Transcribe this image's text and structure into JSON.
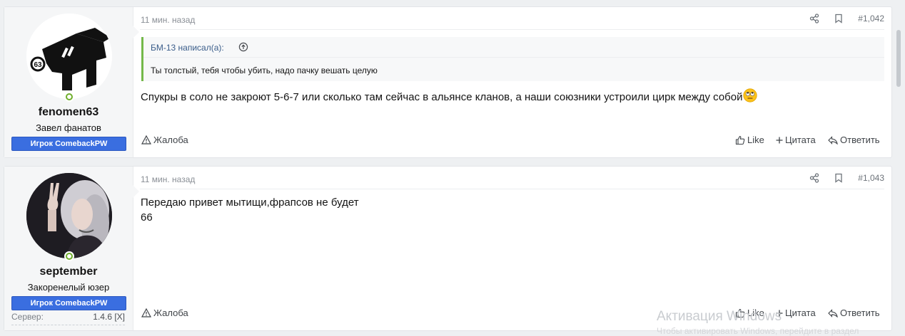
{
  "posts": [
    {
      "username": "fenomen63",
      "user_title": "Завел фанатов",
      "banner": "Игрок ComebackPW",
      "time": "11 мин. назад",
      "post_number": "#1,042",
      "quote": {
        "author": "БМ-13 написал(а):",
        "text": "Ты толстый, тебя чтобы убить, надо пачку вешать целую"
      },
      "message_lines": [
        "Спукры в соло не закроют 5-6-7 или сколько там сейчас в альянсе кланов, а наши союзники устроили цирк между собой"
      ],
      "report_label": "Жалоба",
      "like_label": "Like",
      "quote_label": "Цитата",
      "reply_label": "Ответить"
    },
    {
      "username": "september",
      "user_title": "Закоренелый юзер",
      "banner": "Игрок ComebackPW",
      "extra_label": "Сервер:",
      "extra_value": "1.4.6 [X]",
      "time": "11 мин. назад",
      "post_number": "#1,043",
      "message_lines": [
        "Передаю привет мытищи,фрапсов не будет",
        "66"
      ],
      "report_label": "Жалоба",
      "like_label": "Like",
      "quote_label": "Цитата",
      "reply_label": "Ответить"
    }
  ],
  "watermark": {
    "line1": "Активация Windows",
    "line2": "Чтобы активировать Windows, перейдите в раздел"
  },
  "colors": {
    "banner": "#3a6ee0",
    "quote_border": "#74b84a",
    "online": "#6fae2c"
  }
}
